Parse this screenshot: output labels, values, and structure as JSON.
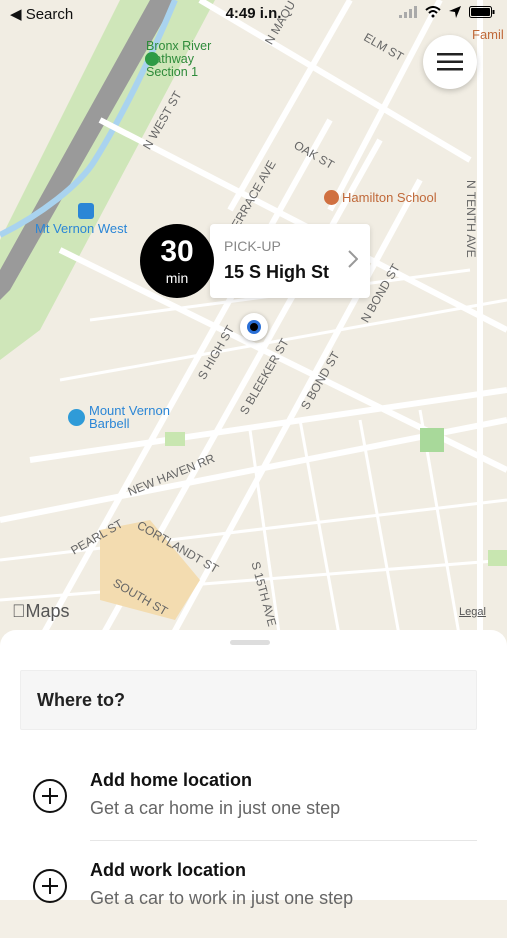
{
  "status": {
    "back_label": "◀ Search",
    "time": "4:49 i.n."
  },
  "map": {
    "labels": {
      "bronx": "Bronx River\nPathway\nSection 1",
      "hamilton": "Hamilton School",
      "mtvernon_west": "Mt Vernon West",
      "barbell": "Mount Vernon\nBarbell",
      "fami": "Famil",
      "streets": {
        "n_west": "N WEST ST",
        "terrace": "TERRACE AVE",
        "oak": "OAK ST",
        "elm": "ELM ST",
        "n_macquesten": "N MAQU",
        "n_bond": "N BOND ST",
        "n_tenth": "N TENTH AVE",
        "s_high": "S HIGH ST",
        "s_bleeker": "S BLEEKER ST",
        "s_bond": "S BOND ST",
        "new_haven": "NEW HAVEN RR",
        "pearl": "PEARL ST",
        "cortlandt": "CORTLANDT ST",
        "south": "SOUTH ST",
        "s_15th": "S 15TH AVE"
      }
    },
    "maps_logo": "Maps",
    "legal": "Legal"
  },
  "pickup": {
    "eta_number": "30",
    "eta_unit": "min",
    "label": "PICK-UP",
    "address": "15 S High St"
  },
  "sheet": {
    "where_to": "Where to?",
    "items": [
      {
        "title": "Add home location",
        "subtitle": "Get a car home in just one step"
      },
      {
        "title": "Add work location",
        "subtitle": "Get a car to work in just one step"
      }
    ]
  }
}
